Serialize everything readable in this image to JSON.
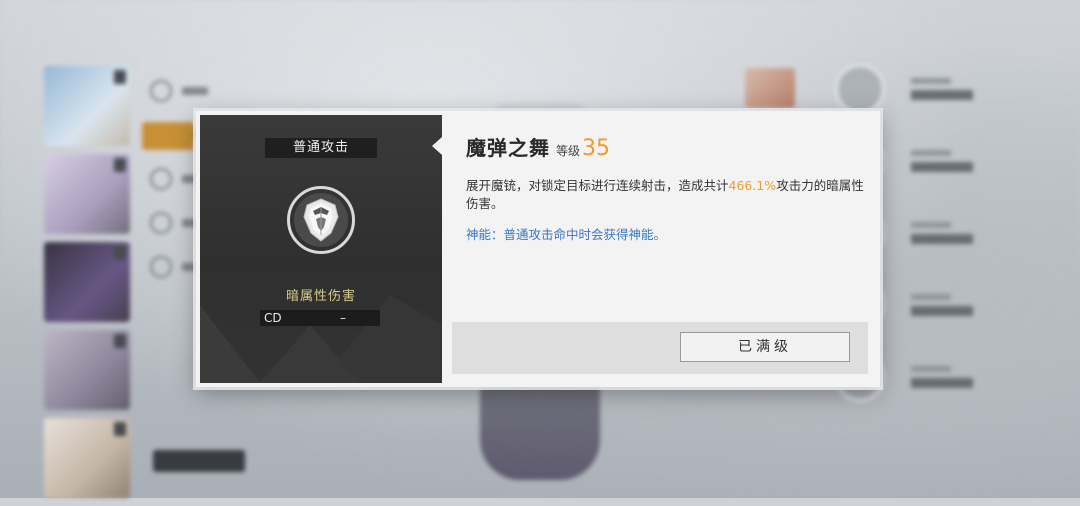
{
  "skill_panel": {
    "category": "普通攻击",
    "damage_type": "暗属性伤害",
    "cd_label": "CD",
    "cd_value": "–"
  },
  "skill_info": {
    "name": "魔弹之舞",
    "level_label": "等级",
    "level_value": "35",
    "description_prefix": "展开魔铳，对锁定目标进行连续射击，造成共计",
    "description_highlight": "466.1%",
    "description_suffix": "攻击力的暗属性伤害。",
    "extra_note": "神能：普通攻击命中时会获得神能。",
    "max_button_label": "已满级"
  },
  "icons": {
    "skill_icon": "dark-shield-emblem-icon"
  },
  "colors": {
    "level_accent": "#f29a2e",
    "damage_type_text": "#d7cc8a",
    "extra_note_text": "#3a78c2"
  }
}
